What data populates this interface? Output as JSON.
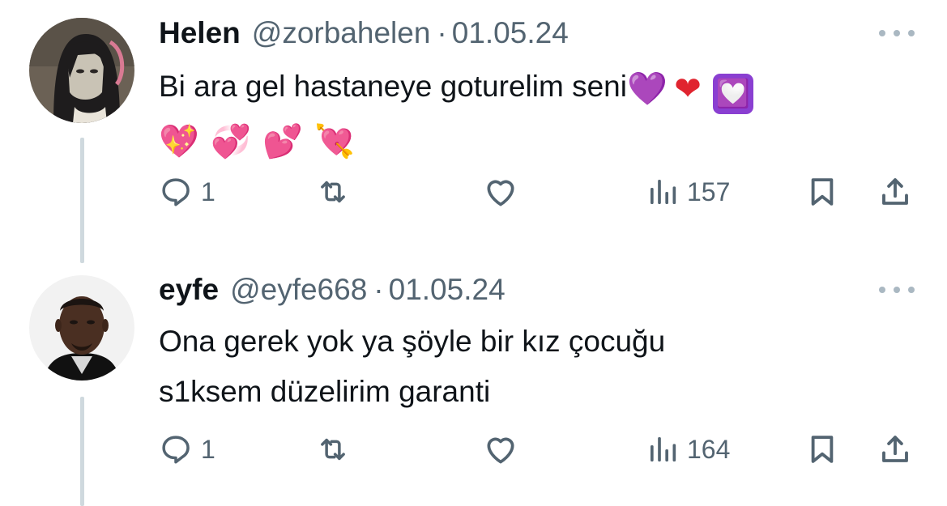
{
  "tweets": [
    {
      "name": "Helen",
      "handle": "@zorbahelen",
      "separator": "·",
      "date": "01.05.24",
      "text_line1": "Bi ara gel hastaneye goturelim seni",
      "emoji_line1": [
        "💜",
        "❤",
        "💟"
      ],
      "emoji_line2": [
        "💖",
        "💞",
        "💕",
        "💘"
      ],
      "reply_count": "1",
      "view_count": "157",
      "avatar": "anime-girl-avatar"
    },
    {
      "name": "eyfe",
      "handle": "@eyfe668",
      "separator": "·",
      "date": "01.05.24",
      "text_line1": "Ona gerek yok ya şöyle bir kız çocuğu",
      "text_line2": "s1ksem düzelirim garanti",
      "reply_count": "1",
      "view_count": "164",
      "avatar": "man-portrait-avatar"
    }
  ],
  "icons": {
    "reply": "reply-icon",
    "retweet": "retweet-icon",
    "like": "heart-icon",
    "views": "views-chart-icon",
    "bookmark": "bookmark-icon",
    "share": "share-icon",
    "more": "more-dots-icon"
  },
  "colors": {
    "text": "#0f1419",
    "muted": "#536471",
    "thread_line": "#cfd9de"
  }
}
